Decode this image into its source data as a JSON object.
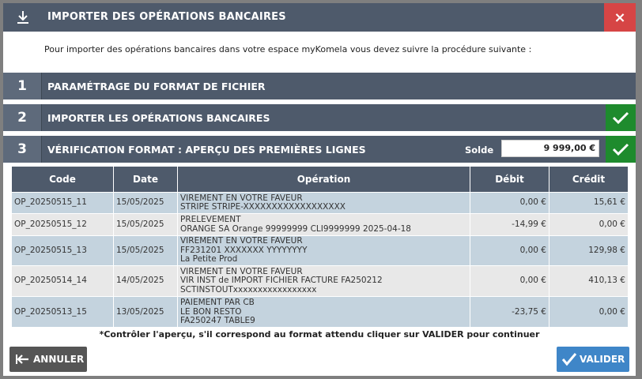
{
  "modal": {
    "title": "IMPORTER DES OPÉRATIONS BANCAIRES",
    "close_label": "×",
    "intro": "Pour importer des opérations bancaires dans votre espace myKomela vous devez suivre la procédure suivante :"
  },
  "steps": [
    {
      "num": "1",
      "title": "PARAMÉTRAGE DU FORMAT DE FICHIER"
    },
    {
      "num": "2",
      "title": "IMPORTER LES OPÉRATIONS BANCAIRES"
    },
    {
      "num": "3",
      "title": "VÉRIFICATION FORMAT : APERÇU DES PREMIÈRES LIGNES"
    }
  ],
  "solde": {
    "label": "Solde",
    "value": "9 999,00 €"
  },
  "table": {
    "headers": [
      "Code",
      "Date",
      "Opération",
      "Débit",
      "Crédit"
    ],
    "rows": [
      {
        "code": "OP_20250515_11",
        "date": "15/05/2025",
        "op": [
          "VIREMENT EN VOTRE FAVEUR",
          "STRIPE STRIPE-XXXXXXXXXXXXXXXXXX"
        ],
        "debit": "0,00 €",
        "credit": "15,61 €"
      },
      {
        "code": "OP_20250515_12",
        "date": "15/05/2025",
        "op": [
          "PRELEVEMENT",
          "ORANGE SA Orange 99999999 CLI9999999 2025-04-18"
        ],
        "debit": "-14,99 €",
        "credit": "0,00 €"
      },
      {
        "code": "OP_20250515_13",
        "date": "15/05/2025",
        "op": [
          "VIREMENT EN VOTRE FAVEUR",
          "FF231201 XXXXXXX YYYYYYYY",
          "La Petite Prod"
        ],
        "debit": "0,00 €",
        "credit": "129,98 €"
      },
      {
        "code": "OP_20250514_14",
        "date": "14/05/2025",
        "op": [
          "VIREMENT EN VOTRE FAVEUR",
          "VIR INST de IMPORT FICHIER FACTURE FA250212",
          "SCTINSTOUTxxxxxxxxxxxxxxxxx"
        ],
        "debit": "0,00 €",
        "credit": "410,13 €"
      },
      {
        "code": "OP_20250513_15",
        "date": "13/05/2025",
        "op": [
          "PAIEMENT PAR CB",
          "LE BON RESTO",
          "FA250247 TABLE9"
        ],
        "debit": "-23,75 €",
        "credit": "0,00 €"
      }
    ]
  },
  "note": "*Contrôler l'aperçu, s'il correspond au format attendu cliquer sur VALIDER pour continuer",
  "buttons": {
    "cancel": "ANNULER",
    "validate": "VALIDER"
  },
  "colors": {
    "header": "#4e5a6b",
    "close": "#d64545",
    "check": "#1e8b2d",
    "validate": "#3f86c8",
    "row_blue": "#c4d3de",
    "row_grey": "#e8e8e8"
  }
}
